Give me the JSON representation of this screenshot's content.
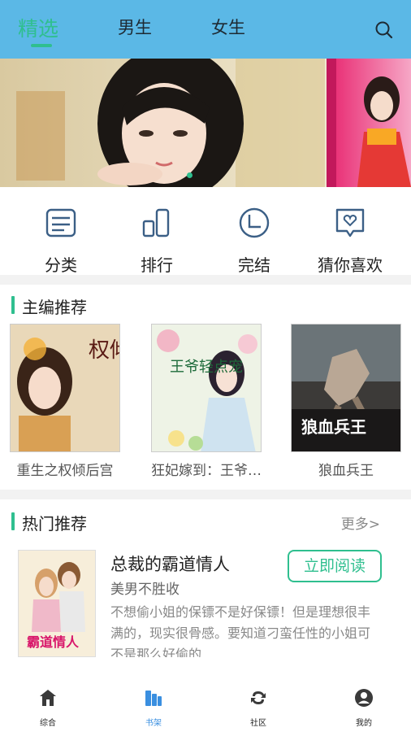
{
  "header": {
    "tabs": [
      {
        "label": "精选",
        "active": true
      },
      {
        "label": "男生",
        "active": false
      },
      {
        "label": "女生",
        "active": false
      }
    ],
    "search_icon": "search-icon"
  },
  "quick_entries": [
    {
      "label": "分类",
      "icon": "category-icon"
    },
    {
      "label": "排行",
      "icon": "ranking-icon"
    },
    {
      "label": "完结",
      "icon": "completed-icon"
    },
    {
      "label": "猜你喜欢",
      "icon": "guess-like-icon"
    }
  ],
  "editor_recommend": {
    "title": "主编推荐",
    "books": [
      {
        "title": "重生之权倾后宫",
        "cover_text": "权倾后宫"
      },
      {
        "title": "狂妃嫁到：王爷…",
        "cover_text": "王爷轻点宠"
      },
      {
        "title": "狼血兵王",
        "cover_text": "狼血兵王"
      }
    ]
  },
  "hot_recommend": {
    "title": "热门推荐",
    "more": "更多>",
    "book": {
      "title": "总裁的霸道情人",
      "author": "美男不胜收",
      "description": "不想偷小姐的保镖不是好保镖！但是理想很丰满的，现实很骨感。要知道刁蛮任性的小姐可不是那么好偷的…",
      "cover_text": "霸道情人",
      "read_button": "立即阅读"
    }
  },
  "bottom_nav": [
    {
      "label": "综合",
      "icon": "home-icon",
      "active": false
    },
    {
      "label": "书架",
      "icon": "bookshelf-icon",
      "active": true
    },
    {
      "label": "社区",
      "icon": "community-icon",
      "active": false
    },
    {
      "label": "我的",
      "icon": "profile-icon",
      "active": false
    }
  ],
  "colors": {
    "header_bg": "#5bb8e6",
    "accent": "#2fbf8f",
    "active_nav": "#3a8fe0"
  }
}
